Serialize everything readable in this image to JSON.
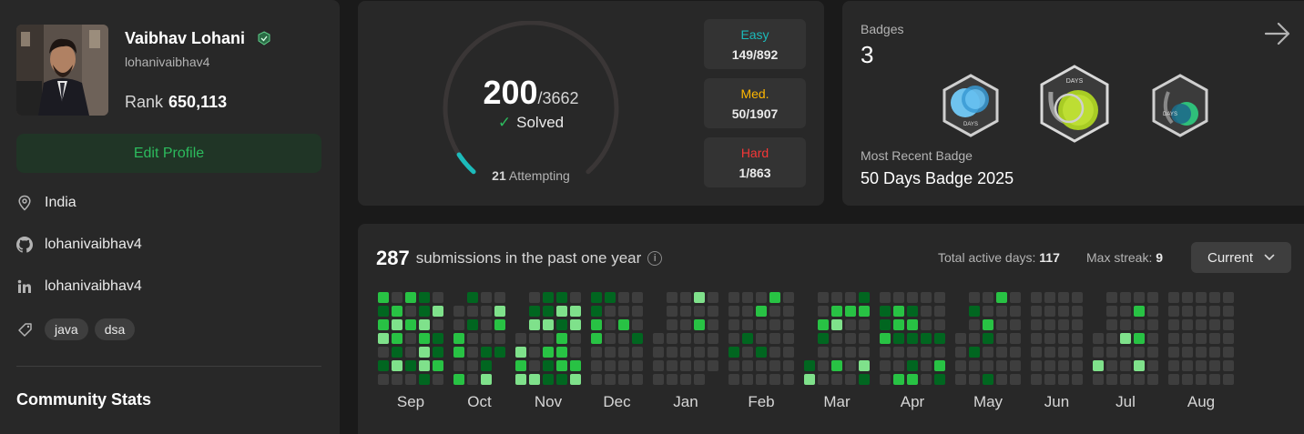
{
  "profile": {
    "name": "Vaibhav Lohani",
    "username": "lohanivaibhav4",
    "rank_label": "Rank",
    "rank_value": "650,113",
    "edit_button": "Edit Profile",
    "location": "India",
    "github": "lohanivaibhav4",
    "linkedin": "lohanivaibhav4",
    "tags": [
      "java",
      "dsa"
    ],
    "community_title": "Community Stats"
  },
  "solved": {
    "count": "200",
    "total": "/3662",
    "label": "Solved",
    "attempting_count": "21",
    "attempting_label": "Attempting",
    "solved_fraction": 0.0546,
    "difficulties": [
      {
        "label": "Easy",
        "value": "149/892",
        "color": "#1cbaba"
      },
      {
        "label": "Med.",
        "value": "50/1907",
        "color": "#ffb700"
      },
      {
        "label": "Hard",
        "value": "1/863",
        "color": "#f63737"
      }
    ]
  },
  "badges": {
    "label": "Badges",
    "count": "3",
    "badge_text": "DAYS",
    "recent_label": "Most Recent Badge",
    "recent_name": "50 Days Badge 2025"
  },
  "calendar": {
    "submissions_count": "287",
    "submissions_text": "submissions in the past one year",
    "active_days_label": "Total active days:",
    "active_days_value": "117",
    "max_streak_label": "Max streak:",
    "max_streak_value": "9",
    "dropdown_label": "Current",
    "months": [
      "Sep",
      "Oct",
      "Nov",
      "Dec",
      "Jan",
      "Feb",
      "Mar",
      "Apr",
      "May",
      "Jun",
      "Jul",
      "Aug"
    ],
    "colors": {
      "empty": "#3e3e3e",
      "level1": "#016620",
      "level2": "#28c244",
      "level3": "#7fe18b"
    }
  }
}
